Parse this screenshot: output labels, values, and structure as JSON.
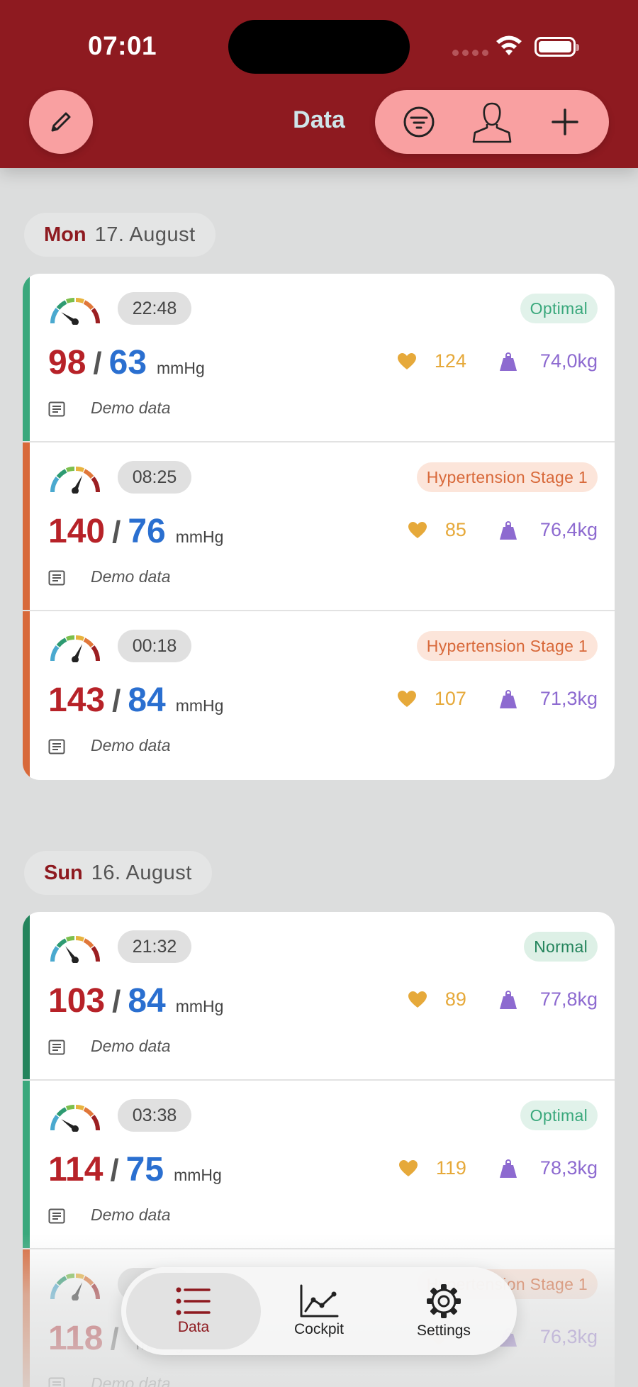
{
  "status_bar": {
    "time": "07:01"
  },
  "header": {
    "title": "Data"
  },
  "colors": {
    "brand": "#8e1a20",
    "systolic": "#b72228",
    "diastolic": "#2a6fd0",
    "pulse": "#e6a93a",
    "weight": "#8d6ad0",
    "optimal": "#3aa87c",
    "normal": "#24845c",
    "stage1": "#d8693a"
  },
  "unit": "mmHg",
  "days": [
    {
      "weekday": "Mon",
      "date": "17. August",
      "entries": [
        {
          "time": "22:48",
          "category": "Optimal",
          "systolic": "98",
          "diastolic": "63",
          "pulse": "124",
          "weight": "74,0kg",
          "note": "Demo data"
        },
        {
          "time": "08:25",
          "category": "Hypertension Stage 1",
          "systolic": "140",
          "diastolic": "76",
          "pulse": "85",
          "weight": "76,4kg",
          "note": "Demo data"
        },
        {
          "time": "00:18",
          "category": "Hypertension Stage 1",
          "systolic": "143",
          "diastolic": "84",
          "pulse": "107",
          "weight": "71,3kg",
          "note": "Demo data"
        }
      ]
    },
    {
      "weekday": "Sun",
      "date": "16. August",
      "entries": [
        {
          "time": "21:32",
          "category": "Normal",
          "systolic": "103",
          "diastolic": "84",
          "pulse": "89",
          "weight": "77,8kg",
          "note": "Demo data"
        },
        {
          "time": "03:38",
          "category": "Optimal",
          "systolic": "114",
          "diastolic": "75",
          "pulse": "119",
          "weight": "78,3kg",
          "note": "Demo data"
        },
        {
          "time": "",
          "category": "Hypertension Stage 1",
          "systolic": "118",
          "diastolic": "",
          "pulse": "",
          "weight": "76,3kg",
          "note": "Demo data"
        }
      ]
    }
  ],
  "tab_bar": {
    "data_label": "Data",
    "cockpit_label": "Cockpit",
    "settings_label": "Settings"
  }
}
